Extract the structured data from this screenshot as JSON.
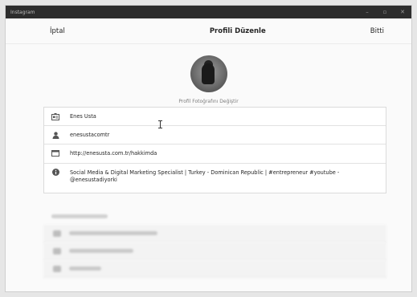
{
  "window": {
    "app_name": "Instagram",
    "controls": {
      "minimize": "–",
      "maximize": "▫",
      "close": "✕"
    }
  },
  "header": {
    "cancel_label": "İptal",
    "title": "Profili Düzenle",
    "done_label": "Bitti"
  },
  "profile": {
    "change_photo_label": "Profil Fotoğrafını Değiştir"
  },
  "form": {
    "name": "Enes Usta",
    "username": "enesustacomtr",
    "website": "http://enesusta.com.tr/hakkimda",
    "bio": "Social Media & Digital Marketing Specialist | Turkey - Dominican Republic | #entrepreneur #youtube - @enesustadiyorki"
  },
  "icons": {
    "name": "id-card-icon",
    "username": "person-icon",
    "website": "browser-window-icon",
    "bio": "info-icon"
  },
  "colors": {
    "titlebar": "#2d2d2d",
    "background": "#fafafa",
    "border": "#dbdbdb",
    "text": "#262626",
    "muted": "#7d7d7d"
  }
}
